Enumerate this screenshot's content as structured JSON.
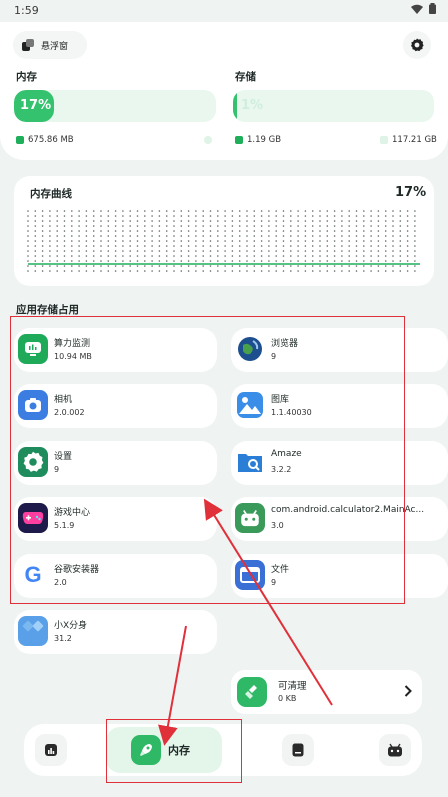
{
  "status_bar": {
    "time": "1:59"
  },
  "float_button": {
    "label": "悬浮窗"
  },
  "memory": {
    "label": "内存",
    "percent_text": "17%",
    "percent": 17,
    "used_text": "675.86 MB",
    "free_text": ""
  },
  "storage": {
    "label": "存储",
    "percent_text": "1%",
    "percent": 1,
    "used_text": "1.19 GB",
    "total_text": "117.21 GB"
  },
  "curve": {
    "title": "内存曲线",
    "percent_text": "17%"
  },
  "apps_section": {
    "title": "应用存储占用"
  },
  "apps": [
    {
      "name": "算力监测",
      "size": "10.94 MB",
      "icon": "monitor-icon",
      "color": "#1faa5a"
    },
    {
      "name": "浏览器",
      "size": "9",
      "icon": "globe-icon",
      "color": "#2f6fb5"
    },
    {
      "name": "相机",
      "size": "2.0.002",
      "icon": "camera-icon",
      "color": "#3b7de0"
    },
    {
      "name": "图库",
      "size": "1.1.40030",
      "icon": "gallery-icon",
      "color": "#3b8ee8"
    },
    {
      "name": "设置",
      "size": "9",
      "icon": "gear-icon",
      "color": "#1e8c5c"
    },
    {
      "name": "Amaze",
      "size": "3.2.2",
      "icon": "folder-search-icon",
      "color": "#2b7ed6"
    },
    {
      "name": "游戏中心",
      "size": "5.1.9",
      "icon": "gamepad-icon",
      "color": "#1e1b4b"
    },
    {
      "name": "com.android.calculator2.MainAc...",
      "size": "3.0",
      "icon": "android-icon",
      "color": "#3a9a5a"
    },
    {
      "name": "谷歌安装器",
      "size": "2.0",
      "icon": "google-icon",
      "color": "#ffffff"
    },
    {
      "name": "文件",
      "size": "9",
      "icon": "files-icon",
      "color": "#3a6fd6"
    },
    {
      "name": "小X分身",
      "size": "31.2",
      "icon": "clone-icon",
      "color": "#5aa0e8"
    }
  ],
  "cleanable": {
    "label": "可清理",
    "value": "0 KB"
  },
  "nav": {
    "active_label": "内存"
  },
  "colors": {
    "accent": "#1fae5a",
    "annotation": "#e0303a"
  }
}
